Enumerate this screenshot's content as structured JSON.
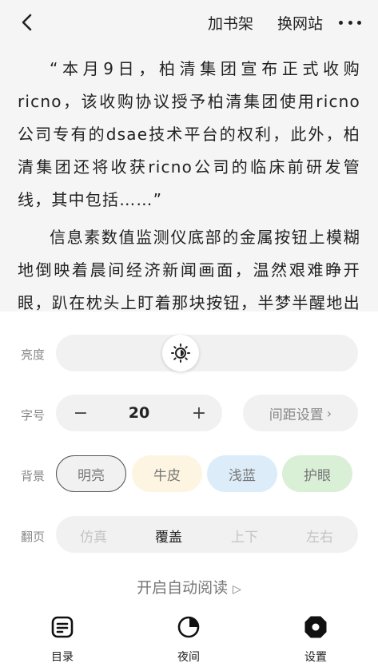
{
  "header": {
    "add_shelf": "加书架",
    "change_site": "换网站"
  },
  "reading": {
    "paragraphs": [
      "“本月9日，柏清集团宣布正式收购ricno，该收购协议授予柏清集团使用ricno公司专有的dsae技术平台的权利，此外，柏清集团还将收获ricno公司的临床前研发管线，其中包括……”",
      "信息素数值监测仪底部的金属按钮上模糊地倒映着晨间经济新闻画面，温然艰难睁开眼，趴在枕头上盯着那块按钮，半梦半醒地出神。"
    ]
  },
  "settings": {
    "brightness_label": "亮度",
    "brightness_level": 0.3,
    "font_label": "字号",
    "font_minus": "−",
    "font_size": "20",
    "font_plus": "+",
    "spacing_label": "间距设置",
    "bg_label": "背景",
    "backgrounds": [
      {
        "label": "明亮",
        "color": "#f1f1f1",
        "selected": true
      },
      {
        "label": "牛皮",
        "color": "#fdf5e2",
        "selected": false
      },
      {
        "label": "浅蓝",
        "color": "#dcecf9",
        "selected": false
      },
      {
        "label": "护眼",
        "color": "#d9efd6",
        "selected": false
      }
    ],
    "page_label": "翻页",
    "page_modes": [
      "仿真",
      "覆盖",
      "上下",
      "左右"
    ],
    "page_mode_selected": "覆盖",
    "auto_read": "开启自动阅读"
  },
  "bottom_nav": {
    "toc": "目录",
    "night": "夜间",
    "settings": "设置"
  }
}
